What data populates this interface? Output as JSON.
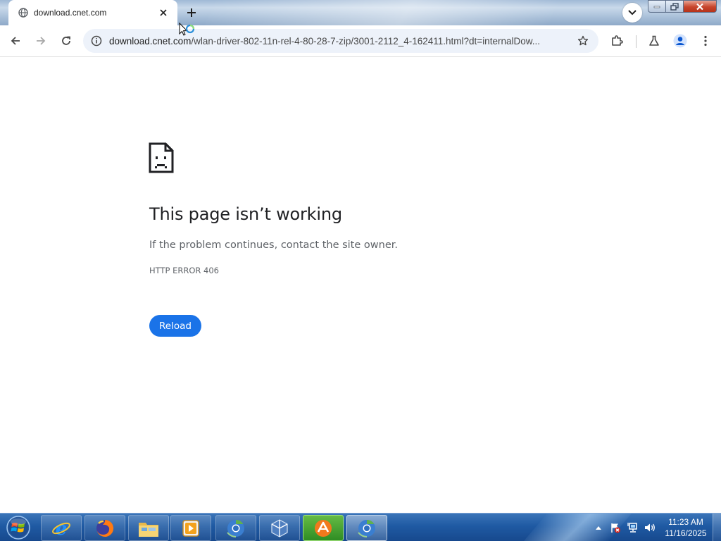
{
  "browser": {
    "tab": {
      "title": "download.cnet.com",
      "favicon": "globe-icon",
      "close_icon": "close-icon"
    },
    "new_tab_icon": "plus-icon",
    "tab_search_icon": "chevron-down-icon",
    "window_controls": [
      "minimize-icon",
      "restore-icon",
      "close-icon"
    ],
    "toolbar": {
      "back_icon": "arrow-left-icon",
      "forward_icon": "arrow-right-icon",
      "reload_icon": "reload-icon",
      "site_info_icon": "info-icon",
      "url_host": "download.cnet.com",
      "url_path": "/wlan-driver-802-11n-rel-4-80-28-7-zip/3001-2112_4-162411.html?dt=internalDow...",
      "bookmark_icon": "star-icon",
      "extensions_icon": "puzzle-icon",
      "labs_icon": "flask-icon",
      "profile_icon": "avatar-icon",
      "menu_icon": "kebab-menu-icon"
    }
  },
  "error_page": {
    "icon": "sad-page-icon",
    "title": "This page isn’t working",
    "description": "If the problem continues, contact the site owner.",
    "code": "HTTP ERROR 406",
    "reload_label": "Reload",
    "accent_color": "#1a73e8"
  },
  "taskbar": {
    "start_icon": "windows-start-icon",
    "pinned": [
      {
        "name": "internet-explorer-icon"
      },
      {
        "name": "firefox-icon"
      },
      {
        "name": "file-explorer-icon"
      },
      {
        "name": "media-player-icon"
      },
      {
        "name": "chrome-remote-icon"
      },
      {
        "name": "virtualbox-icon"
      },
      {
        "name": "streamer-app-icon"
      },
      {
        "name": "chrome-browser-icon"
      }
    ],
    "tray": {
      "show_hidden_icon": "caret-up-icon",
      "flag_icon": "action-center-icon",
      "network_icon": "network-icon",
      "volume_icon": "volume-icon",
      "time": "11:23 AM",
      "date": "11/16/2025"
    }
  }
}
